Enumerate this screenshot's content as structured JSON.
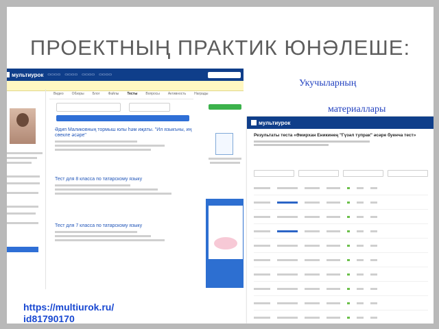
{
  "slide": {
    "title": "ПРОЕКТНЫҢ ПРАКТИК ЮНӘЛЕШЕ:",
    "caption_line1": "Укучыларның",
    "caption_line2": "материаллары",
    "link_line1": "https://multiurok.ru/",
    "link_line2": "id81790170"
  },
  "screenshot_left": {
    "brand": "мультиурок",
    "menu": [],
    "tabs": [
      "Видео",
      "Обзоры",
      "Блог",
      "Файлы",
      "Тесты",
      "Вопросы",
      "Активность",
      "Награды"
    ],
    "items": [
      {
        "title": "Әдип Маликовның тормыш юлы һәм иҗаты. \"Ил языкъны, иң сөекле әсәре\""
      },
      {
        "title": "Тест для 8 класса по татарскому языку"
      },
      {
        "title": "Тест для 7 класса по татарскому языку"
      }
    ]
  },
  "screenshot_right": {
    "brand": "мультиурок",
    "title": "Результаты теста «Әмирхан Еникинең \"Гүзәл тупрак\" әсәре буенча тест»"
  },
  "colors": {
    "nav": "#0f3e8a",
    "caption": "#1f3fbf",
    "link": "#1747d1",
    "title": "#5d5d5d"
  }
}
